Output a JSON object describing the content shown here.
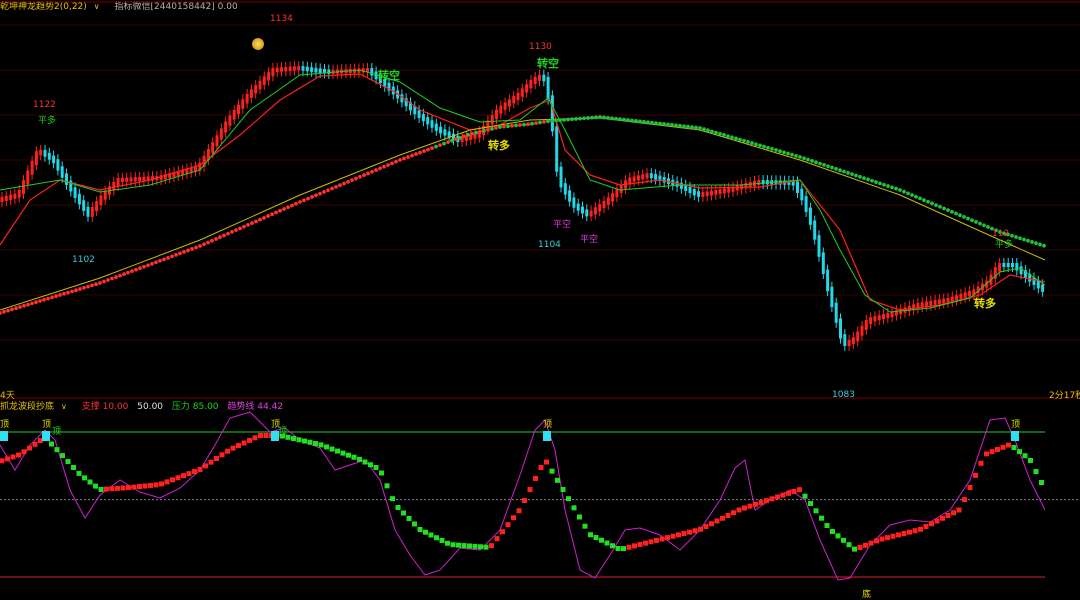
{
  "top_header": {
    "indicator_name": "乾坤神龙趋势2(0,22)",
    "indicator_contact": "指标微信[2440158442] 0.00"
  },
  "main_panel": {
    "price_labels": {
      "high_1134": "1134",
      "high_1130": "1130",
      "high_1122": "1122",
      "low_1102": "1102",
      "low_1104": "1104",
      "low_1083": "1083",
      "right_label": "112"
    },
    "signals": {
      "ping_duo_1": "平多",
      "zhuan_kong_1": "转空",
      "zhuan_duo_1": "转多",
      "zhuan_kong_2": "转空",
      "ping_kong_1": "平空",
      "ping_kong_2": "平空",
      "zhuan_duo_2": "转多",
      "ping_duo_2": "平多"
    },
    "left_bottom_label": "4天",
    "timer": "2分17秒",
    "colors": {
      "up": "#ff2020",
      "down": "#20d8e8",
      "ma_red": "#ff2020",
      "ma_green": "#20d020",
      "ma_yellow": "#c8c000",
      "dots_green": "#20c040",
      "dots_red": "#ff3030"
    }
  },
  "sub_panel": {
    "name": "抓龙波段抄底",
    "legend": {
      "support": "支撑 10.00",
      "middle": "50.00",
      "pressure": "压力 85.00",
      "trend": "趋势线 44.42"
    },
    "marks": {
      "top": "顶",
      "bottom": "底"
    },
    "levels": {
      "pressure": 85,
      "middle": 50,
      "support": 10,
      "trend": 44.42
    }
  }
}
